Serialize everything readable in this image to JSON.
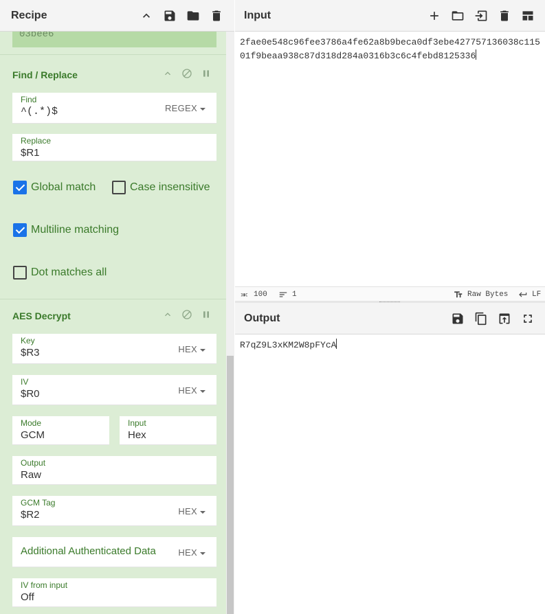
{
  "recipe": {
    "title": "Recipe",
    "prev_tail": "03bee6",
    "find_replace": {
      "title": "Find / Replace",
      "find_label": "Find",
      "find_value": "^(.*)$",
      "find_type": "REGEX",
      "replace_label": "Replace",
      "replace_value": "$R1",
      "global_match": "Global match",
      "case_insensitive": "Case insensitive",
      "multiline": "Multiline matching",
      "dot_all": "Dot matches all"
    },
    "aes": {
      "title": "AES Decrypt",
      "key_label": "Key",
      "key_value": "$R3",
      "key_type": "HEX",
      "iv_label": "IV",
      "iv_value": "$R0",
      "iv_type": "HEX",
      "mode_label": "Mode",
      "mode_value": "GCM",
      "input_label": "Input",
      "input_value": "Hex",
      "output_label": "Output",
      "output_value": "Raw",
      "tag_label": "GCM Tag",
      "tag_value": "$R2",
      "tag_type": "HEX",
      "aad_label": "Additional Authenticated Data",
      "aad_type": "HEX",
      "iv_from_input_label": "IV from input",
      "iv_from_input_value": "Off"
    }
  },
  "input": {
    "title": "Input",
    "text": "2fae0e548c96fee3786a4fe62a8b9beca0df3ebe427757136038c11501f9beaa938c87d318d284a0316b3c6c4febd8125336",
    "status_length": "100",
    "status_lines": "1",
    "status_encoding": "Raw Bytes",
    "status_eol": "LF"
  },
  "output": {
    "title": "Output",
    "text": "R7qZ9L3xKM2W8pFYcA"
  }
}
